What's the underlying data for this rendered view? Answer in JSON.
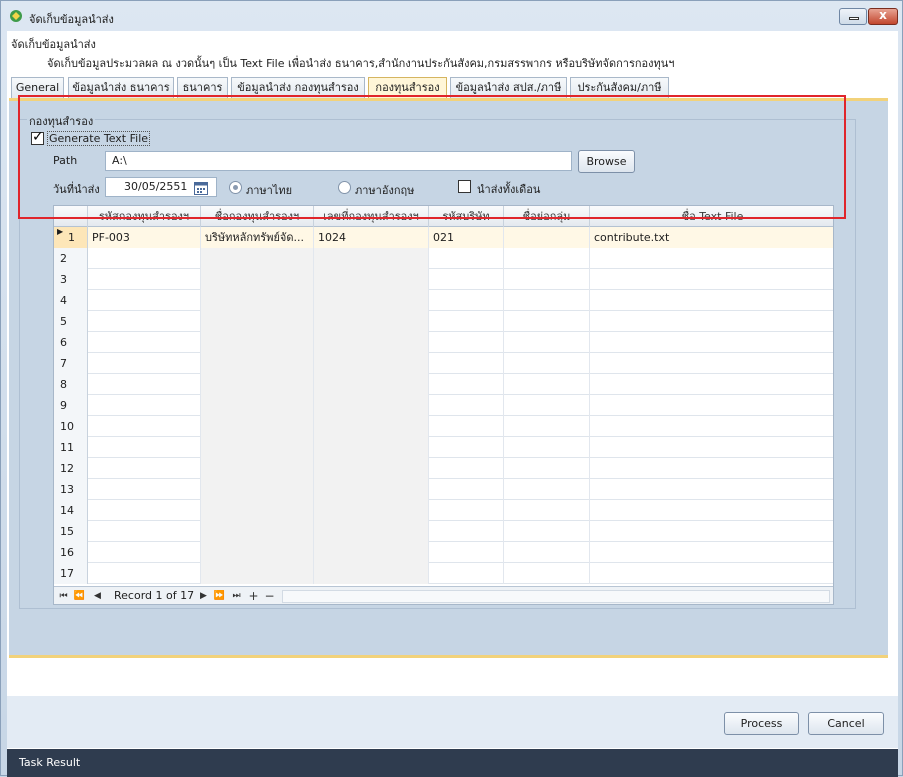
{
  "window": {
    "title": "จัดเก็บข้อมูลนำส่ง",
    "close_glyph": "x"
  },
  "header": {
    "title": "จัดเก็บข้อมูลนำส่ง",
    "description": "จัดเก็บข้อมูลประมวลผล ณ งวดนั้นๆ เป็น Text File เพื่อนำส่ง ธนาคาร,สำนักงานประกันสังคม,กรมสรรพากร หรือบริษัทจัดการกองทุนฯ"
  },
  "tabs": [
    {
      "label": "General"
    },
    {
      "label": "ข้อมูลนำส่ง ธนาคาร"
    },
    {
      "label": "ธนาคาร"
    },
    {
      "label": "ข้อมูลนำส่ง กองทุนสำรอง"
    },
    {
      "label": "กองทุนสำรอง"
    },
    {
      "label": "ข้อมูลนำส่ง สปส./ภาษี"
    },
    {
      "label": "ประกันสังคม/ภาษี"
    }
  ],
  "active_tab": "กองทุนสำรอง",
  "group": {
    "label": "กองทุนสำรอง"
  },
  "form": {
    "generate_label": "Generate Text File",
    "generate_checked": true,
    "path_label": "Path",
    "path_value": "A:\\",
    "browse_label": "Browse",
    "date_label": "วันที่นำส่ง",
    "date_value": "30/05/2551",
    "radio_thai": "ภาษาไทย",
    "radio_eng": "ภาษาอังกฤษ",
    "monthly_label": "นำส่งทั้งเดือน"
  },
  "grid": {
    "columns": [
      "รหัสกองทุนสำรองฯ",
      "ชื่อกองทุนสำรองฯ",
      "เลขที่กองทุนสำรองฯ",
      "รหัสบริษัท",
      "ชื่อย่อกลุ่ม",
      "ชื่อ Text File"
    ],
    "rows": [
      {
        "num": "1",
        "cells": [
          "PF-003",
          "บริษัทหลักทรัพย์จัด...",
          "1024",
          "021",
          "",
          "contribute.txt"
        ]
      },
      {
        "num": "2",
        "cells": [
          "",
          "",
          "",
          "",
          "",
          ""
        ]
      },
      {
        "num": "3",
        "cells": [
          "",
          "",
          "",
          "",
          "",
          ""
        ]
      },
      {
        "num": "4",
        "cells": [
          "",
          "",
          "",
          "",
          "",
          ""
        ]
      },
      {
        "num": "5",
        "cells": [
          "",
          "",
          "",
          "",
          "",
          ""
        ]
      },
      {
        "num": "6",
        "cells": [
          "",
          "",
          "",
          "",
          "",
          ""
        ]
      },
      {
        "num": "7",
        "cells": [
          "",
          "",
          "",
          "",
          "",
          ""
        ]
      },
      {
        "num": "8",
        "cells": [
          "",
          "",
          "",
          "",
          "",
          ""
        ]
      },
      {
        "num": "9",
        "cells": [
          "",
          "",
          "",
          "",
          "",
          ""
        ]
      },
      {
        "num": "10",
        "cells": [
          "",
          "",
          "",
          "",
          "",
          ""
        ]
      },
      {
        "num": "11",
        "cells": [
          "",
          "",
          "",
          "",
          "",
          ""
        ]
      },
      {
        "num": "12",
        "cells": [
          "",
          "",
          "",
          "",
          "",
          ""
        ]
      },
      {
        "num": "13",
        "cells": [
          "",
          "",
          "",
          "",
          "",
          ""
        ]
      },
      {
        "num": "14",
        "cells": [
          "",
          "",
          "",
          "",
          "",
          ""
        ]
      },
      {
        "num": "15",
        "cells": [
          "",
          "",
          "",
          "",
          "",
          ""
        ]
      },
      {
        "num": "16",
        "cells": [
          "",
          "",
          "",
          "",
          "",
          ""
        ]
      },
      {
        "num": "17",
        "cells": [
          "",
          "",
          "",
          "",
          "",
          ""
        ]
      }
    ],
    "record_text": "Record 1 of 17"
  },
  "actions": {
    "process": "Process",
    "cancel": "Cancel"
  },
  "status": {
    "text": "Task Result"
  },
  "colors": {
    "highlight": "#e0252b",
    "panel": "#c6d5e4",
    "tab_active": "#fff6d8",
    "status_bar": "#2f3c4f"
  }
}
